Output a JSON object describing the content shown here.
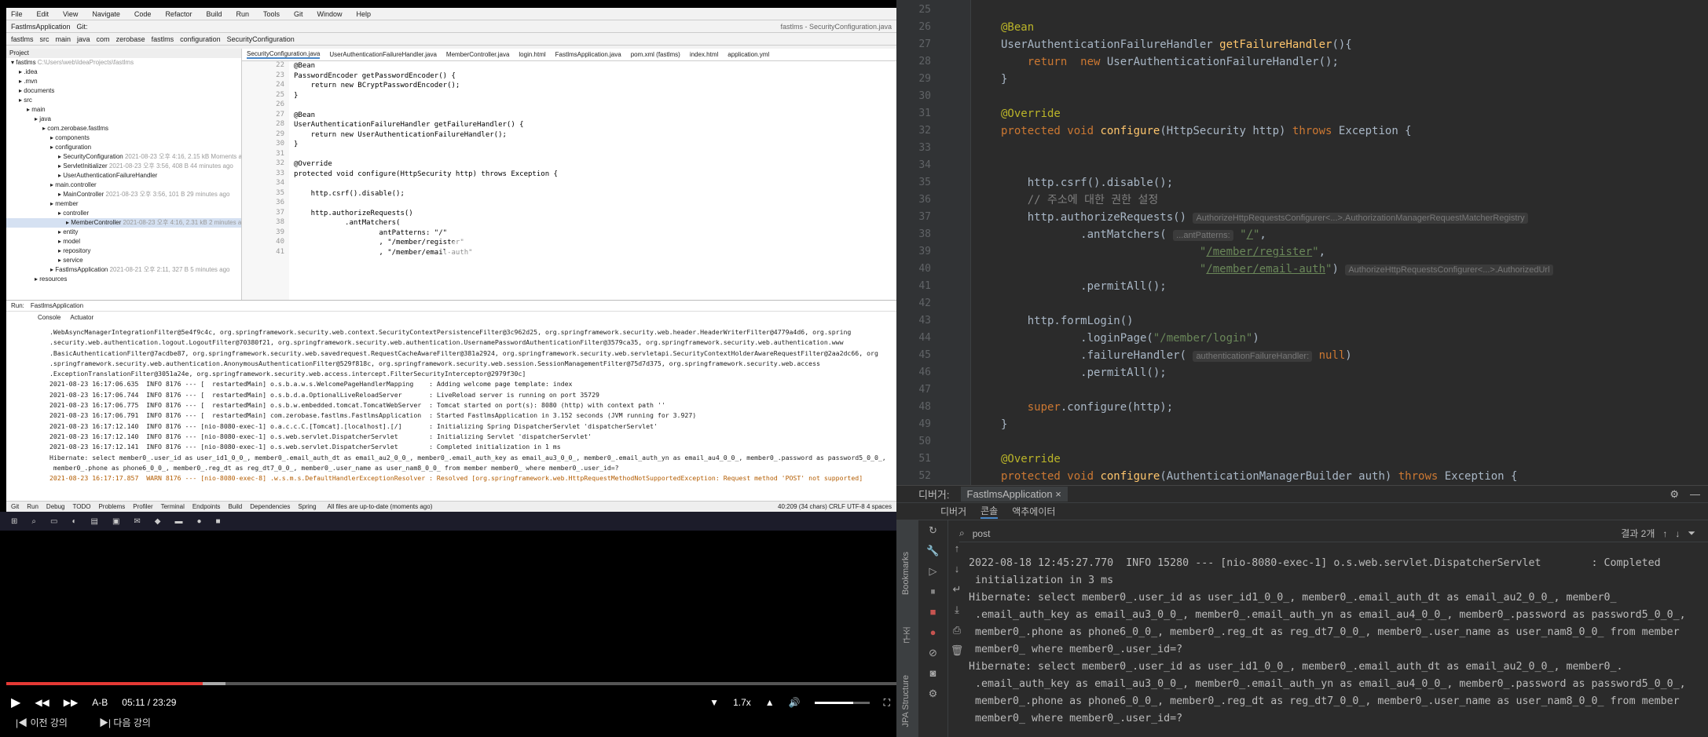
{
  "small_ide": {
    "menu": [
      "File",
      "Edit",
      "View",
      "Navigate",
      "Code",
      "Refactor",
      "Build",
      "Run",
      "Tools",
      "Git",
      "Window",
      "Help"
    ],
    "window_title": "fastlms - SecurityConfiguration.java",
    "run_config": "FastlmsApplication",
    "git_label": "Git:",
    "breadcrumb": [
      "fastlms",
      "src",
      "main",
      "java",
      "com",
      "zerobase",
      "fastlms",
      "configuration",
      "SecurityConfiguration"
    ],
    "project_label": "Project",
    "tabs": [
      "SecurityConfiguration.java",
      "UserAuthenticationFailureHandler.java",
      "MemberController.java",
      "login.html",
      "FastlmsApplication.java",
      "pom.xml (fastlms)",
      "index.html",
      "application.yml"
    ],
    "tree": [
      {
        "t": "fastlms",
        "meta": "C:\\Users\\web\\IdeaProjects\\fastlms",
        "d": 0
      },
      {
        "t": ".idea",
        "d": 1
      },
      {
        "t": ".mvn",
        "d": 1
      },
      {
        "t": "documents",
        "d": 1
      },
      {
        "t": "src",
        "d": 1
      },
      {
        "t": "main",
        "d": 2
      },
      {
        "t": "java",
        "d": 3
      },
      {
        "t": "com.zerobase.fastlms",
        "d": 4
      },
      {
        "t": "components",
        "d": 5
      },
      {
        "t": "configuration",
        "d": 5
      },
      {
        "t": "SecurityConfiguration",
        "meta": "2021-08-23 오후 4:16, 2.15 kB Moments ago",
        "d": 6
      },
      {
        "t": "ServletInitializer",
        "meta": "2021-08-23 오후 3:56, 408 B 44 minutes ago",
        "d": 6
      },
      {
        "t": "UserAuthenticationFailureHandler",
        "d": 6
      },
      {
        "t": "main.controller",
        "d": 5
      },
      {
        "t": "MainController",
        "meta": "2021-08-23 오후 3:56, 101 B 29 minutes ago",
        "d": 6
      },
      {
        "t": "member",
        "d": 5
      },
      {
        "t": "controller",
        "d": 6
      },
      {
        "t": "MemberController",
        "meta": "2021-08-23 오후 4:16, 2.31 kB 2 minutes ago",
        "d": 7
      },
      {
        "t": "entity",
        "d": 6
      },
      {
        "t": "model",
        "d": 6
      },
      {
        "t": "repository",
        "d": 6
      },
      {
        "t": "service",
        "d": 6
      },
      {
        "t": "FastlmsApplication",
        "meta": "2021-08-21 오후 2:11, 327 B 5 minutes ago",
        "d": 5
      },
      {
        "t": "resources",
        "d": 3
      }
    ],
    "code_lines": [
      {
        "n": "22",
        "c": "@Bean"
      },
      {
        "n": "23",
        "c": "PasswordEncoder getPasswordEncoder() {"
      },
      {
        "n": "24",
        "c": "    return new BCryptPasswordEncoder();"
      },
      {
        "n": "25",
        "c": "}"
      },
      {
        "n": "26",
        "c": ""
      },
      {
        "n": "27",
        "c": "@Bean"
      },
      {
        "n": "28",
        "c": "UserAuthenticationFailureHandler getFailureHandler() {"
      },
      {
        "n": "29",
        "c": "    return new UserAuthenticationFailureHandler();"
      },
      {
        "n": "30",
        "c": "}"
      },
      {
        "n": "31",
        "c": ""
      },
      {
        "n": "32",
        "c": "@Override"
      },
      {
        "n": "33",
        "c": "protected void configure(HttpSecurity http) throws Exception {"
      },
      {
        "n": "34",
        "c": ""
      },
      {
        "n": "35",
        "c": "    http.csrf().disable();"
      },
      {
        "n": "36",
        "c": ""
      },
      {
        "n": "37",
        "c": "    http.authorizeRequests()"
      },
      {
        "n": "38",
        "c": "            .antMatchers("
      },
      {
        "n": "39",
        "c": "                    antPatterns: \"/\""
      },
      {
        "n": "40",
        "c": "                    , \"/member/register\""
      },
      {
        "n": "41",
        "c": "                    , \"/member/email-auth\""
      }
    ],
    "run_tabs": [
      "Run:",
      "FastlmsApplication"
    ],
    "console_tabs": [
      "Console",
      "Actuator"
    ],
    "log": [
      ".WebAsyncManagerIntegrationFilter@5e4f9c4c, org.springframework.security.web.context.SecurityContextPersistenceFilter@3c962d25, org.springframework.security.web.header.HeaderWriterFilter@4779a4d6, org.spring",
      ".security.web.authentication.logout.LogoutFilter@70380f21, org.springframework.security.web.authentication.UsernamePasswordAuthenticationFilter@3579ca35, org.springframework.security.web.authentication.www",
      ".BasicAuthenticationFilter@7acdbe87, org.springframework.security.web.savedrequest.RequestCacheAwareFilter@381a2924, org.springframework.security.web.servletapi.SecurityContextHolderAwareRequestFilter@2aa2dc66, org",
      ".springframework.security.web.authentication.AnonymousAuthenticationFilter@529f818c, org.springframework.security.web.session.SessionManagementFilter@75d7d375, org.springframework.security.web.access",
      ".ExceptionTranslationFilter@3051a24e, org.springframework.security.web.access.intercept.FilterSecurityInterceptor@2979f30c]",
      "2021-08-23 16:17:06.635  INFO 8176 --- [  restartedMain] o.s.b.a.w.s.WelcomePageHandlerMapping    : Adding welcome page template: index",
      "2021-08-23 16:17:06.744  INFO 8176 --- [  restartedMain] o.s.b.d.a.OptionalLiveReloadServer       : LiveReload server is running on port 35729",
      "2021-08-23 16:17:06.775  INFO 8176 --- [  restartedMain] o.s.b.w.embedded.tomcat.TomcatWebServer  : Tomcat started on port(s): 8080 (http) with context path ''",
      "2021-08-23 16:17:06.791  INFO 8176 --- [  restartedMain] com.zerobase.fastlms.FastlmsApplication  : Started FastlmsApplication in 3.152 seconds (JVM running for 3.927)",
      "2021-08-23 16:17:12.140  INFO 8176 --- [nio-8080-exec-1] o.a.c.c.C.[Tomcat].[localhost].[/]       : Initializing Spring DispatcherServlet 'dispatcherServlet'",
      "2021-08-23 16:17:12.140  INFO 8176 --- [nio-8080-exec-1] o.s.web.servlet.DispatcherServlet        : Initializing Servlet 'dispatcherServlet'",
      "2021-08-23 16:17:12.141  INFO 8176 --- [nio-8080-exec-1] o.s.web.servlet.DispatcherServlet        : Completed initialization in 1 ms",
      "Hibernate: select member0_.user_id as user_id1_0_0_, member0_.email_auth_dt as email_au2_0_0_, member0_.email_auth_key as email_au3_0_0_, member0_.email_auth_yn as email_au4_0_0_, member0_.password as password5_0_0_,",
      " member0_.phone as phone6_0_0_, member0_.reg_dt as reg_dt7_0_0_, member0_.user_name as user_nam8_0_0_ from member member0_ where member0_.user_id=?",
      "2021-08-23 16:17:17.857  WARN 8176 --- [nio-8080-exec-8] .w.s.m.s.DefaultHandlerExceptionResolver : Resolved [org.springframework.web.HttpRequestMethodNotSupportedException: Request method 'POST' not supported]"
    ],
    "bottom_tabs": [
      "Git",
      "Run",
      "Debug",
      "TODO",
      "Problems",
      "Profiler",
      "Terminal",
      "Endpoints",
      "Build",
      "Dependencies",
      "Spring"
    ],
    "status_left": "All files are up-to-date (moments ago)",
    "status_right": "40:209 (34 chars)  CRLF  UTF-8  4 spaces"
  },
  "player": {
    "current_time": "05:11",
    "total_time": "23:29",
    "separator": "/",
    "ab_label": "A-B",
    "speed": "1.7x",
    "progress_fraction": 0.221,
    "buffer_fraction": 0.025,
    "volume_fraction": 0.7,
    "prev_lecture": "이전 강의",
    "next_lecture": "다음 강의"
  },
  "big_ide": {
    "lines": [
      {
        "n": "25",
        "html": ""
      },
      {
        "n": "26",
        "html": "<span class='ann'>@Bean</span>"
      },
      {
        "n": "27",
        "html": "UserAuthenticationFailureHandler <span class='fn'>getFailureHandler</span>(){"
      },
      {
        "n": "28",
        "html": "    <span class='kw'>return</span>  <span class='kw'>new</span> UserAuthenticationFailureHandler();"
      },
      {
        "n": "29",
        "html": "}"
      },
      {
        "n": "30",
        "html": ""
      },
      {
        "n": "31",
        "html": "<span class='ann'>@Override</span>"
      },
      {
        "n": "32",
        "html": "<span class='kw'>protected void</span> <span class='fn'>configure</span>(HttpSecurity http) <span class='kw'>throws</span> Exception {"
      },
      {
        "n": "33",
        "html": ""
      },
      {
        "n": "34",
        "html": ""
      },
      {
        "n": "35",
        "html": "    http.csrf().disable();"
      },
      {
        "n": "36",
        "html": "    <span class='cm'>// 주소에 대한 권한 설정</span>"
      },
      {
        "n": "37",
        "html": "    http.authorizeRequests() <span class='hint'>AuthorizeHttpRequestsConfigurer&lt;...&gt;.AuthorizationManagerRequestMatcherRegistry</span>"
      },
      {
        "n": "38",
        "html": "            .antMatchers( <span class='hint'>...antPatterns:</span> <span class='str'>\"<span class='link'>/</span>\"</span>,"
      },
      {
        "n": "39",
        "html": "                              <span class='str'>\"<span class='link'>/member/register</span>\"</span>,"
      },
      {
        "n": "40",
        "html": "                              <span class='str'>\"<span class='link'>/member/email-auth</span>\"</span>) <span class='hint'>AuthorizeHttpRequestsConfigurer&lt;...&gt;.AuthorizedUrl</span>"
      },
      {
        "n": "41",
        "html": "            .permitAll();"
      },
      {
        "n": "42",
        "html": ""
      },
      {
        "n": "43",
        "html": "    http.formLogin()"
      },
      {
        "n": "44",
        "html": "            .loginPage(<span class='str'>\"/member/login\"</span>)"
      },
      {
        "n": "45",
        "html": "            .failureHandler( <span class='hint'>authenticationFailureHandler:</span> <span class='kw'>null</span>)"
      },
      {
        "n": "46",
        "html": "            .permitAll();"
      },
      {
        "n": "47",
        "html": ""
      },
      {
        "n": "48",
        "html": "    <span class='kw'>super</span>.configure(http);"
      },
      {
        "n": "49",
        "html": "}"
      },
      {
        "n": "50",
        "html": ""
      },
      {
        "n": "51",
        "html": "<span class='ann'>@Override</span>"
      },
      {
        "n": "52",
        "html": "<span class='kw'>protected void</span> <span class='fn'>configure</span>(AuthenticationManagerBuilder auth) <span class='kw'>throws</span> Exception {"
      }
    ],
    "debugger_label": "디버거:",
    "debug_config": "FastlmsApplication",
    "tab_debugger": "디버거",
    "tab_console": "콘솔",
    "tab_actuator": "액추에이터",
    "search_value": "post",
    "match_count": "결과 2개",
    "console": [
      "2022-08-18 12:45:27.770  INFO 15280 --- [nio-8080-exec-1] o.s.web.servlet.DispatcherServlet        : Completed",
      " initialization in 3 ms",
      "Hibernate: select member0_.user_id as user_id1_0_0_, member0_.email_auth_dt as email_au2_0_0_, member0_",
      " .email_auth_key as email_au3_0_0_, member0_.email_auth_yn as email_au4_0_0_, member0_.password as password5_0_0_,",
      " member0_.phone as phone6_0_0_, member0_.reg_dt as reg_dt7_0_0_, member0_.user_name as user_nam8_0_0_ from member",
      " member0_ where member0_.user_id=?",
      "Hibernate: select member0_.user_id as user_id1_0_0_, member0_.email_auth_dt as email_au2_0_0_, member0_.",
      " .email_auth_key as email_au3_0_0_, member0_.email_auth_yn as email_au4_0_0_, member0_.password as password5_0_0_,",
      " member0_.phone as phone6_0_0_, member0_.reg_dt as reg_dt7_0_0_, member0_.user_name as user_nam8_0_0_ from member",
      " member0_ where member0_.user_id=?"
    ],
    "side_labels": [
      "Bookmarks",
      "구조",
      "JPA Structure"
    ]
  },
  "colors": {
    "progress": "#e53935",
    "bg_dark": "#2b2b2b"
  }
}
